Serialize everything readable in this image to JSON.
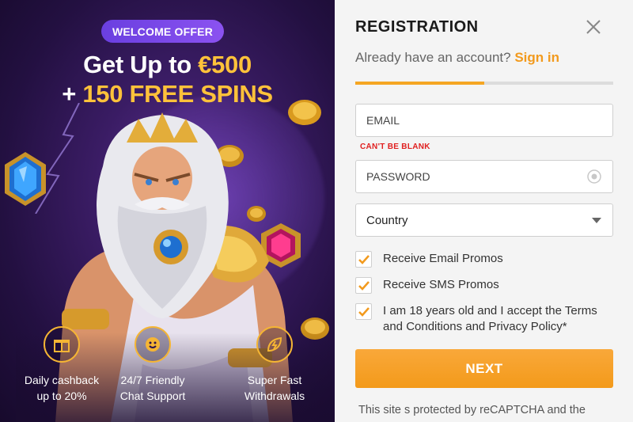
{
  "promo": {
    "badge": "WELCOME OFFER",
    "headline_prefix": "Get Up to ",
    "headline_amount": "€500",
    "headline_line2_prefix": "+ ",
    "headline_line2_gold": "150 FREE SPINS",
    "features": [
      {
        "icon": "gift-icon",
        "line1": "Daily cashback",
        "line2": "up to 20%"
      },
      {
        "icon": "smiley-chat-icon",
        "line1": "24/7 Friendly",
        "line2": "Chat Support"
      },
      {
        "icon": "lightning-leaf-icon",
        "line1": "Super Fast",
        "line2": "Withdrawals"
      }
    ]
  },
  "form": {
    "title": "REGISTRATION",
    "already_text": "Already have an account?",
    "signin_label": "Sign in",
    "progress_fraction": 0.5,
    "email_placeholder": "EMAIL",
    "email_error": "CAN'T BE BLANK",
    "password_placeholder": "PASSWORD",
    "country_value": "Country",
    "checkboxes": [
      {
        "label": "Receive Email Promos",
        "checked": true
      },
      {
        "label": "Receive SMS Promos",
        "checked": true
      },
      {
        "label": "I am 18 years old and I accept the Terms and Conditions and Privacy Policy*",
        "checked": true
      }
    ],
    "next_label": "NEXT",
    "recaptcha_text": "This site s protected by reCAPTCHA and the"
  },
  "colors": {
    "accent": "#f5a623",
    "gold": "#ffc23a",
    "badge": "#7a48e8",
    "error": "#e02020",
    "promo_bg": "#2a1450"
  }
}
